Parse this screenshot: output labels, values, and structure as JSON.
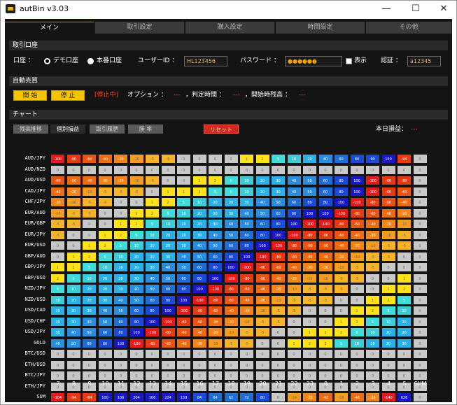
{
  "window": {
    "title": "autBin v3.03",
    "min": "—",
    "max": "☐",
    "close": "✕"
  },
  "tabs": [
    {
      "label": "メイン",
      "active": true
    },
    {
      "label": "取引設定",
      "active": false
    },
    {
      "label": "購入設定",
      "active": false
    },
    {
      "label": "時間設定",
      "active": false
    },
    {
      "label": "その他",
      "active": false
    }
  ],
  "account": {
    "section": "取引口座",
    "label": "口座 ：",
    "demo": "デモ口座",
    "real": "本番口座",
    "user_label": "ユーザーID ：",
    "user_value": "HL123456",
    "pass_label": "パスワード ：",
    "pass_value": "●●●●●●",
    "show": "表示",
    "auth_label": "認証 ：",
    "auth_value": "a12345"
  },
  "auto": {
    "section": "自動売買",
    "start": "開 始",
    "stop": "停 止",
    "status": "[停止中]",
    "info": [
      "オプション ：",
      "---",
      "，判定時間 ：",
      "---",
      "，開始時残高 ：",
      "---"
    ]
  },
  "chart": {
    "section": "チャート",
    "buttons": [
      "残高推移",
      "個別損益",
      "取引履歴",
      "勝 率"
    ],
    "reset": "リセット",
    "today_label": "本日損益：",
    "today_value": "---"
  },
  "chart_data": {
    "type": "heatmap",
    "rows": [
      "AUD/JPY",
      "AUD/NZD",
      "AUD/USD",
      "CAD/JPY",
      "CHF/JPY",
      "EUR/AUD",
      "EUR/GBP",
      "EUR/JPY",
      "EUR/USD",
      "GBP/AUD",
      "GBP/JPY",
      "GBP/USD",
      "NZD/JPY",
      "NZD/USD",
      "USD/CAD",
      "USD/CHF",
      "USD/JPY",
      "GOLD",
      "BTC/USD",
      "ETH/USD",
      "BTC/JPY",
      "ETH/JPY",
      "SUM"
    ],
    "columns": [
      "7",
      "8",
      "9",
      "10",
      "11",
      "12",
      "13",
      "14",
      "15",
      "16",
      "17",
      "18",
      "19",
      "20",
      "21",
      "22",
      "23",
      "0",
      "1",
      "2",
      "3",
      "4",
      "5",
      "SUM"
    ],
    "values": [
      [
        -100,
        -80,
        -60,
        -40,
        -20,
        -10,
        -5,
        -5,
        0,
        0,
        0,
        0,
        1,
        2,
        5,
        10,
        20,
        40,
        60,
        80,
        90,
        100,
        -94,
        0
      ],
      [
        0,
        0,
        0,
        0,
        0,
        0,
        0,
        0,
        0,
        0,
        0,
        0,
        0,
        0,
        0,
        0,
        0,
        0,
        0,
        0,
        0,
        0,
        0,
        0
      ],
      [
        -60,
        -50,
        -40,
        -30,
        -20,
        -10,
        -5,
        0,
        0,
        1,
        2,
        5,
        10,
        20,
        30,
        40,
        50,
        60,
        80,
        100,
        -100,
        -80,
        -80,
        0
      ],
      [
        -40,
        -20,
        -10,
        -5,
        -5,
        -5,
        0,
        1,
        1,
        2,
        5,
        5,
        10,
        20,
        30,
        40,
        50,
        60,
        80,
        100,
        -100,
        -80,
        -60,
        0
      ],
      [
        -20,
        -10,
        -5,
        -5,
        0,
        0,
        1,
        2,
        5,
        10,
        20,
        20,
        30,
        40,
        50,
        60,
        80,
        80,
        100,
        -100,
        -80,
        -60,
        -40,
        0
      ],
      [
        -10,
        -5,
        -5,
        0,
        0,
        1,
        2,
        5,
        10,
        20,
        20,
        30,
        40,
        50,
        60,
        80,
        100,
        100,
        -100,
        -80,
        -60,
        -40,
        -20,
        0
      ],
      [
        -5,
        -5,
        0,
        0,
        1,
        2,
        5,
        10,
        20,
        20,
        30,
        40,
        50,
        60,
        80,
        100,
        -100,
        -100,
        -80,
        -60,
        -40,
        -20,
        -10,
        0
      ],
      [
        -5,
        0,
        0,
        1,
        2,
        5,
        10,
        20,
        20,
        30,
        40,
        50,
        60,
        80,
        100,
        -100,
        -80,
        -80,
        -60,
        -40,
        -20,
        -10,
        -5,
        0
      ],
      [
        0,
        0,
        1,
        2,
        5,
        10,
        20,
        20,
        30,
        40,
        50,
        60,
        80,
        100,
        -100,
        -80,
        -60,
        -60,
        -40,
        -20,
        -10,
        -5,
        -5,
        0
      ],
      [
        0,
        1,
        2,
        5,
        10,
        20,
        20,
        30,
        40,
        50,
        60,
        80,
        100,
        -100,
        -80,
        -60,
        -40,
        -40,
        -20,
        -10,
        -5,
        -5,
        0,
        0
      ],
      [
        1,
        2,
        5,
        10,
        20,
        20,
        30,
        40,
        50,
        60,
        80,
        100,
        -100,
        -80,
        -60,
        -40,
        -20,
        -20,
        -10,
        -5,
        -5,
        0,
        0,
        0
      ],
      [
        2,
        5,
        10,
        20,
        20,
        30,
        40,
        50,
        60,
        80,
        100,
        -100,
        -80,
        -60,
        -40,
        -20,
        -10,
        -10,
        -5,
        -5,
        0,
        0,
        1,
        0
      ],
      [
        5,
        10,
        20,
        20,
        30,
        40,
        50,
        60,
        80,
        100,
        -100,
        -80,
        -60,
        -40,
        -20,
        -10,
        -5,
        -5,
        -5,
        0,
        0,
        1,
        2,
        0
      ],
      [
        10,
        20,
        20,
        30,
        40,
        50,
        60,
        80,
        100,
        -100,
        -80,
        -60,
        -40,
        -20,
        -10,
        -5,
        -5,
        -5,
        0,
        0,
        1,
        2,
        5,
        0
      ],
      [
        20,
        20,
        30,
        40,
        50,
        60,
        80,
        100,
        -100,
        -80,
        -60,
        -40,
        -20,
        -10,
        -5,
        -5,
        0,
        0,
        0,
        1,
        2,
        5,
        10,
        0
      ],
      [
        20,
        30,
        40,
        50,
        60,
        80,
        100,
        -100,
        -80,
        -60,
        -40,
        -20,
        -10,
        -5,
        -5,
        0,
        0,
        0,
        1,
        2,
        5,
        10,
        20,
        0
      ],
      [
        30,
        40,
        50,
        60,
        80,
        100,
        -100,
        -80,
        -60,
        -40,
        -20,
        -10,
        -5,
        -5,
        0,
        0,
        1,
        1,
        2,
        5,
        10,
        20,
        20,
        0
      ],
      [
        40,
        50,
        60,
        80,
        100,
        -100,
        -80,
        -60,
        -40,
        -20,
        -10,
        -5,
        -5,
        0,
        0,
        1,
        2,
        2,
        5,
        10,
        20,
        20,
        30,
        0
      ],
      [
        0,
        0,
        0,
        0,
        0,
        0,
        0,
        0,
        0,
        0,
        0,
        0,
        0,
        0,
        0,
        0,
        0,
        0,
        0,
        0,
        0,
        0,
        0,
        0
      ],
      [
        0,
        0,
        0,
        0,
        0,
        0,
        0,
        0,
        0,
        0,
        0,
        0,
        0,
        0,
        0,
        0,
        0,
        0,
        0,
        0,
        0,
        0,
        0,
        0
      ],
      [
        0,
        0,
        0,
        0,
        0,
        0,
        0,
        0,
        0,
        0,
        0,
        0,
        0,
        0,
        0,
        0,
        0,
        0,
        0,
        0,
        0,
        0,
        0,
        0
      ],
      [
        0,
        0,
        0,
        0,
        0,
        0,
        0,
        0,
        0,
        0,
        0,
        0,
        0,
        0,
        0,
        0,
        0,
        0,
        0,
        0,
        0,
        0,
        0,
        0
      ],
      [
        -104,
        -94,
        -84,
        100,
        106,
        204,
        106,
        224,
        150,
        84,
        64,
        62,
        72,
        80,
        0,
        -14,
        -20,
        -42,
        -18,
        -46,
        -26,
        -140,
        626,
        0
      ]
    ]
  }
}
